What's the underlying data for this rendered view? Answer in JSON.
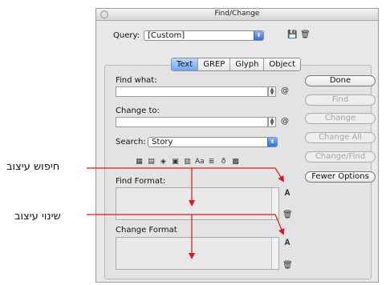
{
  "window": {
    "title": "Find/Change"
  },
  "query": {
    "label": "Query:",
    "value": "[Custom]"
  },
  "tabs": [
    "Text",
    "GREP",
    "Glyph",
    "Object"
  ],
  "find_what": {
    "label": "Find what:",
    "value": ""
  },
  "change_to": {
    "label": "Change to:",
    "value": ""
  },
  "search": {
    "label": "Search:",
    "value": "Story"
  },
  "buttons": {
    "done": "Done",
    "find": "Find",
    "change": "Change",
    "change_all": "Change All",
    "change_find": "Change/Find",
    "fewer_options": "Fewer Options"
  },
  "find_format": {
    "label": "Find Format:"
  },
  "change_format": {
    "label": "Change Format"
  },
  "annotations": {
    "find_format_he": "חיפוש עיצוב",
    "change_format_he": "שינוי עיצוב"
  },
  "colors": {
    "arrow": "#e2161b",
    "tab_active": "#8bb8f5"
  }
}
